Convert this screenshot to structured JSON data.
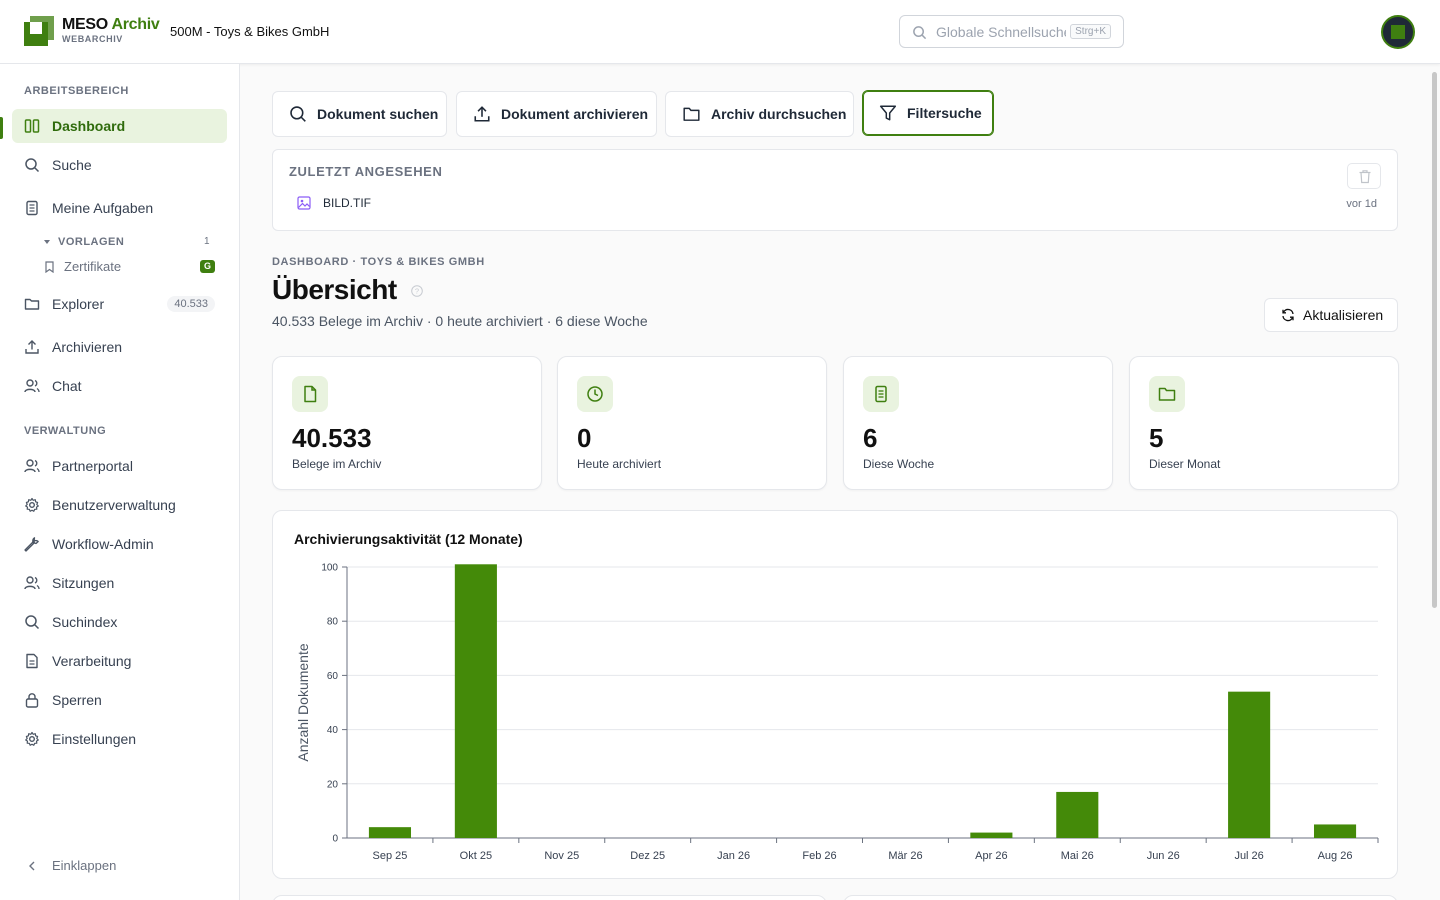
{
  "header": {
    "brand_primary": "MESO",
    "brand_accent": "Archiv",
    "brand_sub": "WEBARCHIV",
    "company": "500M - Toys & Bikes GmbH",
    "search_placeholder": "Globale Schnellsuche",
    "search_shortcut": "Strg+K",
    "accent_color": "#3f7f10"
  },
  "sidebar": {
    "section_workspace": "ARBEITSBEREICH",
    "section_admin": "VERWALTUNG",
    "items": [
      {
        "label": "Dashboard",
        "icon": "dashboard-icon"
      },
      {
        "label": "Suche",
        "icon": "search-icon"
      },
      {
        "label": "Meine Aufgaben",
        "icon": "tasks-icon"
      },
      {
        "label": "Explorer",
        "icon": "folder-icon",
        "count": "40.533"
      },
      {
        "label": "Archivieren",
        "icon": "upload-icon"
      },
      {
        "label": "Chat",
        "icon": "users-icon"
      }
    ],
    "templates": {
      "label": "VORLAGEN",
      "count": "1",
      "item": "Zertifikate",
      "badge": "G"
    },
    "admin_items": [
      {
        "label": "Partnerportal",
        "icon": "users-icon"
      },
      {
        "label": "Benutzerverwaltung",
        "icon": "gear-icon"
      },
      {
        "label": "Workflow-Admin",
        "icon": "wrench-icon"
      },
      {
        "label": "Sitzungen",
        "icon": "users-icon"
      },
      {
        "label": "Suchindex",
        "icon": "search-icon"
      },
      {
        "label": "Verarbeitung",
        "icon": "document-icon"
      },
      {
        "label": "Sperren",
        "icon": "lock-icon"
      },
      {
        "label": "Einstellungen",
        "icon": "gear-icon"
      }
    ],
    "collapse_label": "Einklappen"
  },
  "actions": [
    {
      "label": "Dokument suchen",
      "icon": "search-icon"
    },
    {
      "label": "Dokument archivieren",
      "icon": "upload-icon"
    },
    {
      "label": "Archiv durchsuchen",
      "icon": "folder-icon"
    },
    {
      "label": "Filtersuche",
      "icon": "filter-icon"
    }
  ],
  "recent": {
    "title": "ZULETZT ANGESEHEN",
    "items": [
      {
        "name": "BILD.TIF",
        "time": "vor 1d",
        "icon": "image-icon"
      }
    ]
  },
  "overview": {
    "breadcrumb": "DASHBOARD · TOYS & BIKES GMBH",
    "title": "Übersicht",
    "summary": "40.533 Belege im Archiv · 0 heute archiviert · 6 diese Woche",
    "refresh_label": "Aktualisieren"
  },
  "stats": [
    {
      "value": "40.533",
      "label": "Belege im Archiv",
      "icon": "file-icon"
    },
    {
      "value": "0",
      "label": "Heute archiviert",
      "icon": "clock-icon"
    },
    {
      "value": "6",
      "label": "Diese Woche",
      "icon": "document-icon"
    },
    {
      "value": "5",
      "label": "Dieser Monat",
      "icon": "folder-icon"
    }
  ],
  "chart_data": {
    "type": "bar",
    "title": "Archivierungsaktivität (12 Monate)",
    "xlabel": "",
    "ylabel": "Anzahl Dokumente",
    "categories": [
      "Sep 25",
      "Okt 25",
      "Nov 25",
      "Dez 25",
      "Jan 26",
      "Feb 26",
      "Mär 26",
      "Apr 26",
      "Mai 26",
      "Jun 26",
      "Jul 26",
      "Aug 26"
    ],
    "values": [
      4,
      101,
      0,
      0,
      0,
      0,
      0,
      2,
      17,
      0,
      54,
      5
    ],
    "ylim": [
      0,
      100
    ],
    "yticks": [
      0,
      20,
      40,
      60,
      80,
      100
    ],
    "grid": true,
    "color": "#448a09"
  }
}
